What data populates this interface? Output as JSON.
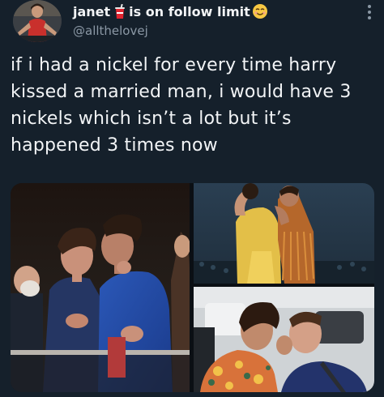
{
  "tweet": {
    "display_name": "janet",
    "name_suffix": "is on follow limit",
    "handle": "@allthelovej",
    "text": "if i had a nickel for every time harry kissed a married man, i would have 3 nickels which isn’t a lot but it’s happened 3 times now",
    "emoji_1": "cup-with-straw-emoji",
    "emoji_2": "smiling-face-emoji",
    "more_icon": "more-options-icon"
  },
  "colors": {
    "background": "#15202b",
    "text_primary": "#f2f4f6",
    "text_secondary": "#8b98a5"
  },
  "media": {
    "count": 3
  }
}
